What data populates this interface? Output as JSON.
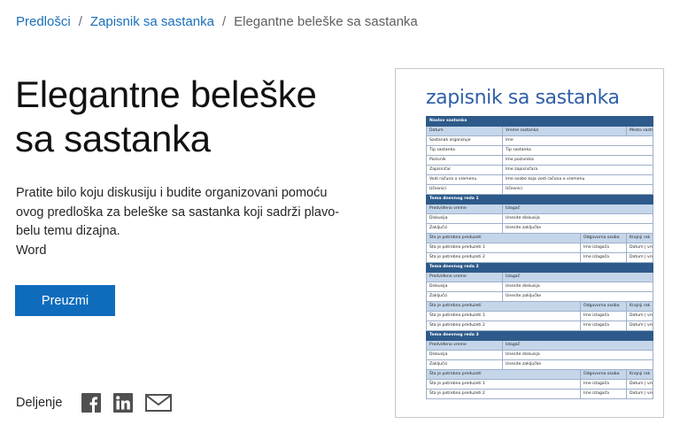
{
  "breadcrumb": {
    "items": [
      "Predlošci",
      "Zapisnik sa sastanka"
    ],
    "separator": "/",
    "current": "Elegantne beleške sa sastanka"
  },
  "title_line1": "Elegantne beleške",
  "title_line2": "sa sastanka",
  "description": "Pratite bilo koju diskusiju i budite organizovani pomoću ovog predloška za beleške sa sastanka koji sadrži plavo-belu temu dizajna.",
  "app": "Word",
  "download_label": "Preuzmi",
  "share": {
    "label": "Deljenje",
    "icons": [
      "facebook-icon",
      "linkedin-icon",
      "email-icon"
    ]
  },
  "colors": {
    "accent": "#0f6cbd",
    "link": "#1a6fb8",
    "doc_title": "#2f5fa7",
    "doc_header": "#2d5a8a",
    "doc_subheader": "#c5d6ea"
  },
  "preview": {
    "title": "zapisnik sa sastanka",
    "rows": [
      {
        "type": "hdr",
        "cells": [
          "Naslov sastanka"
        ]
      },
      {
        "type": "sub",
        "cells": [
          "Datum",
          "Vreme sastanka",
          "Mesto sastanka"
        ]
      },
      {
        "type": "row2",
        "cells": [
          "Sastanak organizuje",
          "Ime"
        ]
      },
      {
        "type": "row2",
        "cells": [
          "Tip sastanka",
          "Tip sastanka"
        ]
      },
      {
        "type": "row2",
        "cells": [
          "Pozivnik",
          "Ime pozivnika"
        ]
      },
      {
        "type": "row2",
        "cells": [
          "Zapisničar",
          "Ime zapisničara"
        ]
      },
      {
        "type": "row2",
        "cells": [
          "Vodi računa o vremenu",
          "Ime osobe koja vodi računa o vremenu"
        ]
      },
      {
        "type": "row2",
        "cells": [
          "Učesnici",
          "Učesnici"
        ]
      },
      {
        "type": "hdr",
        "cells": [
          "Tema dnevnog reda 1"
        ]
      },
      {
        "type": "sub2",
        "cells": [
          "Predviđeno vreme",
          "Izlagač"
        ]
      },
      {
        "type": "row2",
        "cells": [
          "Diskusija",
          "Unesite diskusija"
        ]
      },
      {
        "type": "row2",
        "cells": [
          "Zaključci",
          "Unesite zaključke"
        ]
      },
      {
        "type": "sub4",
        "cells": [
          "Šta je potrebno preduzeti",
          "Odgovorna osoba",
          "Krajnji rok"
        ]
      },
      {
        "type": "row3",
        "cells": [
          "Šta je potrebno preduzeti 1",
          "Ime izlagača",
          "Datum | vreme"
        ]
      },
      {
        "type": "row3",
        "cells": [
          "Šta je potrebno preduzeti 2",
          "Ime izlagača",
          "Datum | vreme"
        ]
      },
      {
        "type": "hdr",
        "cells": [
          "Tema dnevnog reda 2"
        ]
      },
      {
        "type": "sub2",
        "cells": [
          "Predviđeno vreme",
          "Izlagač"
        ]
      },
      {
        "type": "row2",
        "cells": [
          "Diskusija",
          "Unesite diskusija"
        ]
      },
      {
        "type": "row2",
        "cells": [
          "Zaključci",
          "Unesite zaključke"
        ]
      },
      {
        "type": "sub4",
        "cells": [
          "Šta je potrebno preduzeti",
          "Odgovorna osoba",
          "Krajnji rok"
        ]
      },
      {
        "type": "row3",
        "cells": [
          "Šta je potrebno preduzeti 1",
          "Ime izlagača",
          "Datum | vreme"
        ]
      },
      {
        "type": "row3",
        "cells": [
          "Šta je potrebno preduzeti 2",
          "Ime izlagača",
          "Datum | vreme"
        ]
      },
      {
        "type": "hdr",
        "cells": [
          "Tema dnevnog reda 3"
        ]
      },
      {
        "type": "sub2",
        "cells": [
          "Predviđeno vreme",
          "Izlagač"
        ]
      },
      {
        "type": "row2",
        "cells": [
          "Diskusija",
          "Unesite diskusija"
        ]
      },
      {
        "type": "row2",
        "cells": [
          "Zaključci",
          "Unesite zaključke"
        ]
      },
      {
        "type": "sub4",
        "cells": [
          "Šta je potrebno preduzeti",
          "Odgovorna osoba",
          "Krajnji rok"
        ]
      },
      {
        "type": "row3",
        "cells": [
          "Šta je potrebno preduzeti 1",
          "Ime izlagača",
          "Datum | vreme"
        ]
      },
      {
        "type": "row3",
        "cells": [
          "Šta je potrebno preduzeti 2",
          "Ime izlagača",
          "Datum | vreme"
        ]
      }
    ]
  }
}
